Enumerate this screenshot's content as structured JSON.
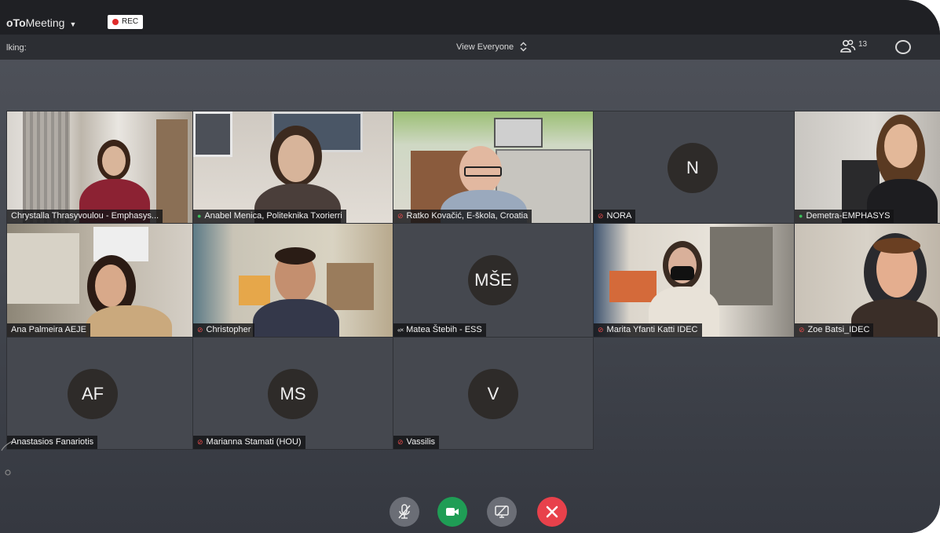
{
  "titlebar": {
    "app_title_bold": "oTo",
    "app_title_rest": "Meeting",
    "rec_label": "REC"
  },
  "subbar": {
    "talking_label": "lking:",
    "view_selector": "View Everyone",
    "participant_count": "13"
  },
  "tiles": [
    {
      "name": "Chrystalla Thrasyvoulou - Emphasys...",
      "mic": "none",
      "video": true
    },
    {
      "name": "Anabel Menica, Politeknika Txorierri",
      "mic": "on",
      "video": true
    },
    {
      "name": "Ratko Kovačić, E-škola, Croatia",
      "mic": "muted",
      "video": true
    },
    {
      "name": "NORA",
      "mic": "muted",
      "video": false,
      "initials": "N"
    },
    {
      "name": "Demetra-EMPHASYS",
      "mic": "on",
      "video": true
    },
    {
      "name": "Ana Palmeira AEJE",
      "mic": "none",
      "video": true
    },
    {
      "name": "Christopher",
      "mic": "muted",
      "video": true
    },
    {
      "name": "Matea Štebih - ESS",
      "mic": "off",
      "video": false,
      "initials": "MŠE"
    },
    {
      "name": "Marita Yfanti Katti IDEC",
      "mic": "muted",
      "video": true
    },
    {
      "name": "Zoe Batsi_IDEC",
      "mic": "muted",
      "video": true
    },
    {
      "name": "Anastasios Fanariotis",
      "mic": "none",
      "video": false,
      "initials": "AF"
    },
    {
      "name": "Marianna Stamati (HOU)",
      "mic": "muted",
      "video": false,
      "initials": "MS"
    },
    {
      "name": "Vassilis",
      "mic": "muted",
      "video": false,
      "initials": "V"
    }
  ],
  "colors": {
    "recording": "#e02b2b",
    "muted": "#e84b4b",
    "unmuted": "#3bbf5a",
    "camera_on": "#1f9d55",
    "leave": "#e8414b"
  },
  "icons": {
    "mic_button": "mic-off-icon",
    "camera_button": "camera-icon",
    "share_button": "screen-share-off-icon",
    "leave_button": "close-icon",
    "participants": "people-icon",
    "chat": "chat-bubble-icon"
  }
}
